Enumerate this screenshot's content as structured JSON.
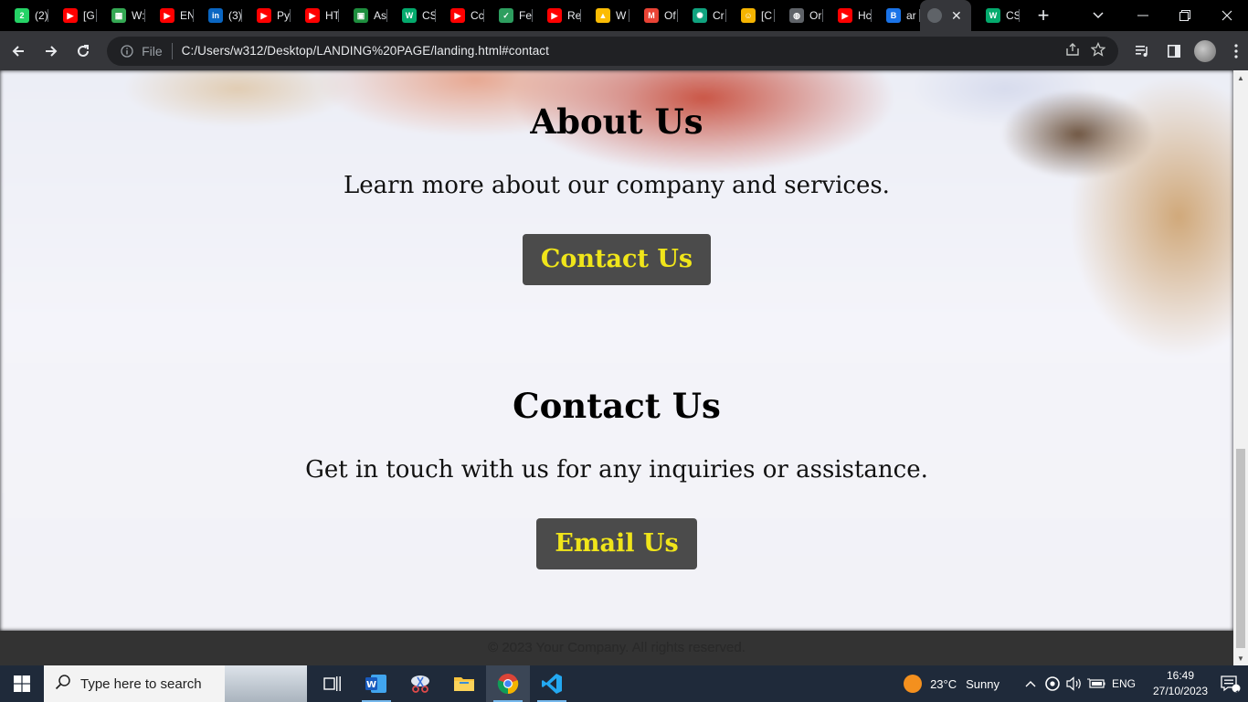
{
  "browser": {
    "tabs": [
      {
        "label": "(2)",
        "icon": "whatsapp-icon",
        "color": "#25d366",
        "glyph": "2"
      },
      {
        "label": "[G",
        "icon": "youtube-icon",
        "color": "#ff0000",
        "glyph": "▶"
      },
      {
        "label": "W:",
        "icon": "maps-icon",
        "color": "#34a853",
        "glyph": "▦"
      },
      {
        "label": "EN",
        "icon": "youtube-icon",
        "color": "#ff0000",
        "glyph": "▶"
      },
      {
        "label": "(3)",
        "icon": "linkedin-icon",
        "color": "#0a66c2",
        "glyph": "in"
      },
      {
        "label": "Py",
        "icon": "youtube-icon",
        "color": "#ff0000",
        "glyph": "▶"
      },
      {
        "label": "HT",
        "icon": "youtube-icon",
        "color": "#ff0000",
        "glyph": "▶"
      },
      {
        "label": "As",
        "icon": "classroom-icon",
        "color": "#1e8e3e",
        "glyph": "▣"
      },
      {
        "label": "CS",
        "icon": "w3schools-icon",
        "color": "#04aa6d",
        "glyph": "W"
      },
      {
        "label": "Cc",
        "icon": "youtube-icon",
        "color": "#ff0000",
        "glyph": "▶"
      },
      {
        "label": "Fe",
        "icon": "shield-icon",
        "color": "#2d9e5f",
        "glyph": "✓"
      },
      {
        "label": "Re",
        "icon": "youtube-icon",
        "color": "#ff0000",
        "glyph": "▶"
      },
      {
        "label": "W",
        "icon": "drive-icon",
        "color": "#fbbc04",
        "glyph": "▲"
      },
      {
        "label": "Of",
        "icon": "gmail-icon",
        "color": "#ea4335",
        "glyph": "M"
      },
      {
        "label": "Cr",
        "icon": "chatgpt-icon",
        "color": "#10a37f",
        "glyph": "✺"
      },
      {
        "label": "[C",
        "icon": "user-icon",
        "color": "#f5b400",
        "glyph": "☺"
      },
      {
        "label": "Or",
        "icon": "globe-icon",
        "color": "#5f6368",
        "glyph": "◍"
      },
      {
        "label": "Hc",
        "icon": "youtube-icon",
        "color": "#ff0000",
        "glyph": "▶"
      },
      {
        "label": "ar",
        "icon": "bing-icon",
        "color": "#1a73e8",
        "glyph": "B"
      }
    ],
    "active_tab_icon": "globe-icon",
    "after_tab": {
      "label": "CS",
      "icon": "w3schools-icon",
      "color": "#04aa6d",
      "glyph": "W"
    },
    "omnibox": {
      "scheme_label": "File",
      "url": "C:/Users/w312/Desktop/LANDING%20PAGE/landing.html#contact"
    }
  },
  "page": {
    "about": {
      "title": "About Us",
      "text": "Learn more about our company and services.",
      "button": "Contact Us"
    },
    "contact": {
      "title": "Contact Us",
      "text": "Get in touch with us for any inquiries or assistance.",
      "button": "Email Us"
    },
    "footer": "© 2023 Your Company. All rights reserved.",
    "colors": {
      "button_bg": "#4b4b4b",
      "button_text": "#f0e51a",
      "footer_bg": "#333333"
    }
  },
  "taskbar": {
    "search_placeholder": "Type here to search",
    "weather": {
      "temp": "23°C",
      "condition": "Sunny"
    },
    "language": "ENG",
    "time": "16:49",
    "date": "27/10/2023",
    "notifications": "1"
  }
}
